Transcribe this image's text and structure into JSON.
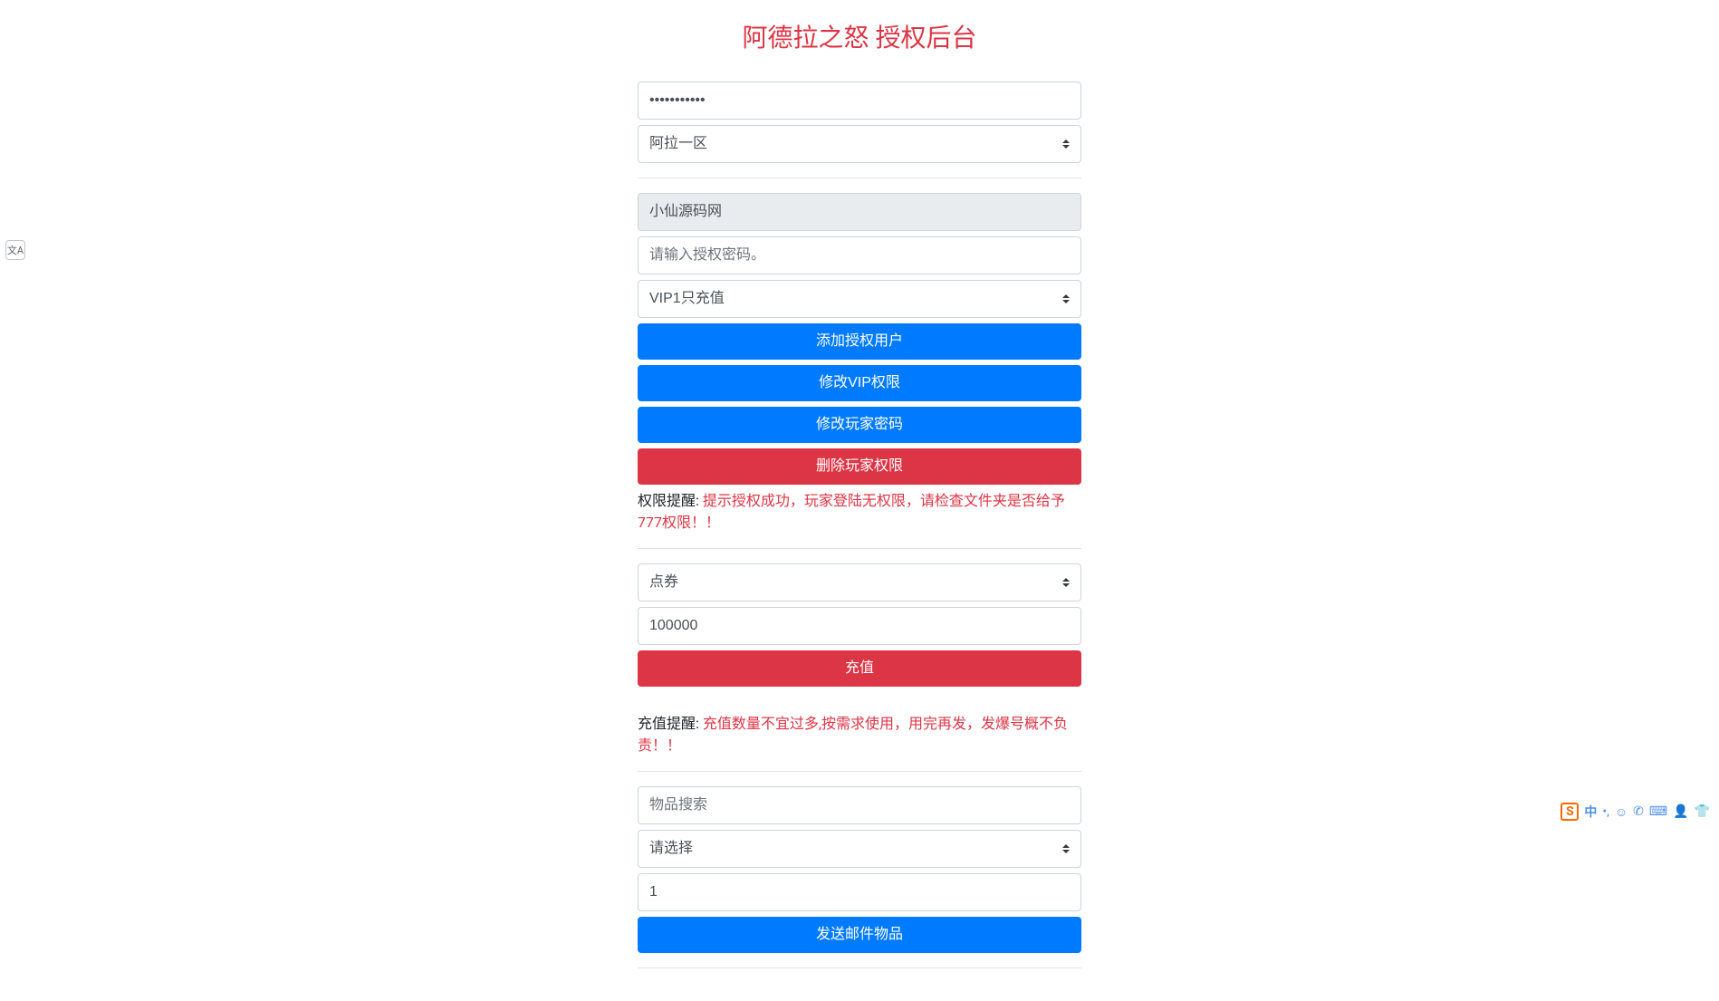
{
  "page_title": "阿德拉之怒 授权后台",
  "section_server": {
    "password_value": "•••••••••••",
    "server_selected": "阿拉一区"
  },
  "section_auth": {
    "username_value": "小仙源码网",
    "auth_code_placeholder": "请输入授权密码。",
    "vip_selected": "VIP1只充值",
    "btn_add": "添加授权用户",
    "btn_modify_vip": "修改VIP权限",
    "btn_modify_password": "修改玩家密码",
    "btn_delete": "删除玩家权限",
    "hint_label": "权限提醒: ",
    "hint_text": "提示授权成功，玩家登陆无权限，请检查文件夹是否给予777权限！！"
  },
  "section_recharge": {
    "type_selected": "点券",
    "amount_value": "100000",
    "btn_recharge": "充值",
    "hint_label": "充值提醒: ",
    "hint_text": "充值数量不宜过多,按需求使用，用完再发，发爆号概不负责！！"
  },
  "section_mail": {
    "search_placeholder": "物品搜索",
    "item_selected": "请选择",
    "qty_value": "1",
    "btn_send": "发送邮件物品"
  },
  "translate_widget": "文A",
  "ime": {
    "logo": "S",
    "lang": "中",
    "punct": "•,",
    "emoji": "☺",
    "mic": "✆",
    "keyboard": "⌨",
    "user": "👤",
    "skin": "👕"
  }
}
